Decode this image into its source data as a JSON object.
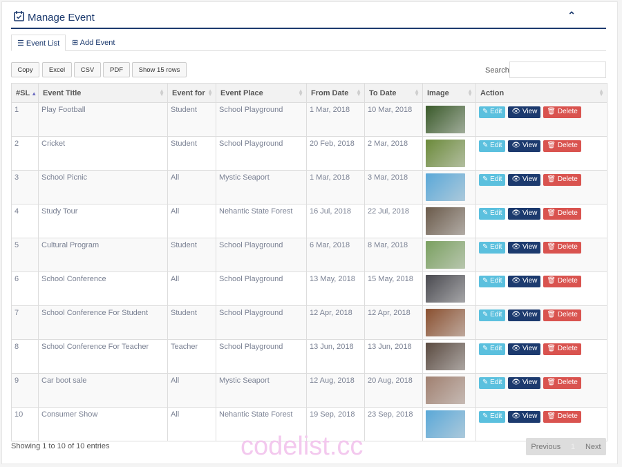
{
  "header": {
    "title": "Manage Event"
  },
  "tabs": [
    {
      "label": "Event List"
    },
    {
      "label": "Add Event"
    }
  ],
  "toolbar": {
    "copy": "Copy",
    "excel": "Excel",
    "csv": "CSV",
    "pdf": "PDF",
    "show": "Show 15 rows",
    "search_label": "Search:",
    "search_value": ""
  },
  "columns": [
    "#SL",
    "Event Title",
    "Event for",
    "Event Place",
    "From Date",
    "To Date",
    "Image",
    "Action"
  ],
  "actions": {
    "edit": "Edit",
    "view": "View",
    "delete": "Delete"
  },
  "rows": [
    {
      "sl": "1",
      "title": "Play Football",
      "for": "Student",
      "place": "School Playground",
      "from": "1 Mar, 2018",
      "to": "10 Mar, 2018",
      "img": "#3a5a2a"
    },
    {
      "sl": "2",
      "title": "Cricket",
      "for": "Student",
      "place": "School Playground",
      "from": "20 Feb, 2018",
      "to": "2 Mar, 2018",
      "img": "#6b8a3a"
    },
    {
      "sl": "3",
      "title": "School Picnic",
      "for": "All",
      "place": "Mystic Seaport",
      "from": "1 Mar, 2018",
      "to": "3 Mar, 2018",
      "img": "#5aa8d8"
    },
    {
      "sl": "4",
      "title": "Study Tour",
      "for": "All",
      "place": "Nehantic State Forest",
      "from": "16 Jul, 2018",
      "to": "22 Jul, 2018",
      "img": "#6a5a4a"
    },
    {
      "sl": "5",
      "title": "Cultural Program",
      "for": "Student",
      "place": "School Playground",
      "from": "6 Mar, 2018",
      "to": "8 Mar, 2018",
      "img": "#7aa060"
    },
    {
      "sl": "6",
      "title": "School Conference",
      "for": "All",
      "place": "School Playground",
      "from": "13 May, 2018",
      "to": "15 May, 2018",
      "img": "#4a4a50"
    },
    {
      "sl": "7",
      "title": "School Conference For Student",
      "for": "Student",
      "place": "School Playground",
      "from": "12 Apr, 2018",
      "to": "12 Apr, 2018",
      "img": "#8a5030"
    },
    {
      "sl": "8",
      "title": "School Conference For Teacher",
      "for": "Teacher",
      "place": "School Playground",
      "from": "13 Jun, 2018",
      "to": "13 Jun, 2018",
      "img": "#5a4a40"
    },
    {
      "sl": "9",
      "title": "Car boot sale",
      "for": "All",
      "place": "Mystic Seaport",
      "from": "12 Aug, 2018",
      "to": "20 Aug, 2018",
      "img": "#a08070"
    },
    {
      "sl": "10",
      "title": "Consumer Show",
      "for": "All",
      "place": "Nehantic State Forest",
      "from": "19 Sep, 2018",
      "to": "23 Sep, 2018",
      "img": "#5aa8d8"
    }
  ],
  "footer": {
    "info": "Showing 1 to 10 of 10 entries",
    "previous": "Previous",
    "page": "1",
    "next": "Next"
  },
  "watermark": "codelist.cc"
}
